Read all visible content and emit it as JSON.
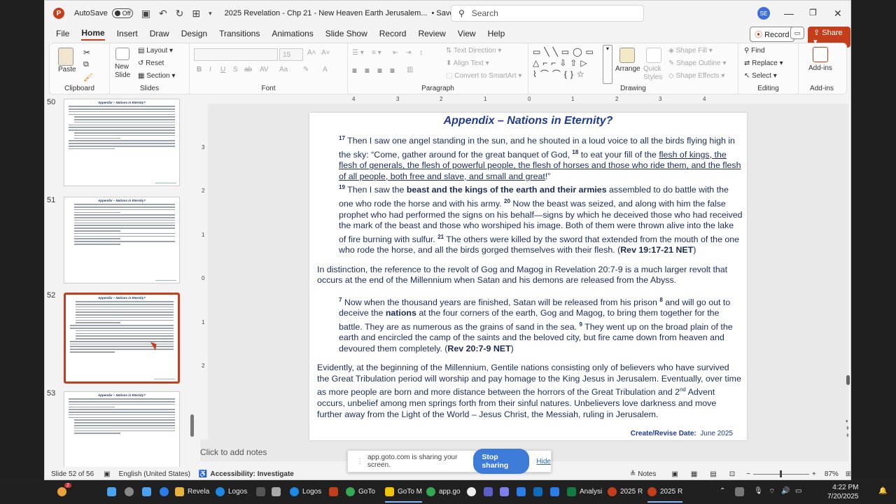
{
  "titlebar": {
    "autosave_label": "AutoSave",
    "autosave_state": "Off",
    "doc_title": "2025 Revelation - Chp 21 - New Heaven Earth Jerusalem...",
    "save_status": "• Saved to this PC",
    "search_placeholder": "Search",
    "user_initials": "SE"
  },
  "menu": {
    "tabs": [
      "File",
      "Home",
      "Insert",
      "Draw",
      "Design",
      "Transitions",
      "Animations",
      "Slide Show",
      "Record",
      "Review",
      "View",
      "Help"
    ],
    "record_button": "Record",
    "share_button": "Share"
  },
  "ribbon": {
    "clipboard": {
      "label": "Clipboard",
      "paste": "Paste"
    },
    "slides": {
      "label": "Slides",
      "new_slide": "New Slide",
      "layout": "Layout",
      "reset": "Reset",
      "section": "Section"
    },
    "font": {
      "label": "Font",
      "size": "15"
    },
    "paragraph": {
      "label": "Paragraph",
      "text_direction": "Text Direction",
      "align_text": "Align Text",
      "convert_smartart": "Convert to SmartArt"
    },
    "drawing": {
      "label": "Drawing",
      "arrange": "Arrange",
      "quick_styles": "Quick Styles",
      "shape_fill": "Shape Fill",
      "shape_outline": "Shape Outline",
      "shape_effects": "Shape Effects"
    },
    "editing": {
      "label": "Editing",
      "find": "Find",
      "replace": "Replace",
      "select": "Select"
    },
    "addins": {
      "label": "Add-ins",
      "addins": "Add-ins"
    }
  },
  "thumbnails": [
    {
      "number": "50",
      "title": "Appendix – Nations in Eternity?"
    },
    {
      "number": "51",
      "title": "Appendix – Nations in Eternity?"
    },
    {
      "number": "52",
      "title": "Appendix – Nations in Eternity?"
    },
    {
      "number": "53",
      "title": "Appendix – Nations in Eternity?"
    }
  ],
  "ruler": {
    "top": [
      "4",
      "3",
      "2",
      "1",
      "0",
      "1",
      "2",
      "3",
      "4"
    ],
    "left": [
      "3",
      "2",
      "1",
      "0",
      "1",
      "2"
    ]
  },
  "slide": {
    "title": "Appendix – Nations in Eternity?",
    "p1_v17": "17",
    "p1_a": " Then I saw one angel standing in the sun, and he shouted in a loud voice to all the birds flying high in the sky: “Come, gather around for the great banquet of God, ",
    "p1_v18": "18",
    "p1_b": " to eat your fill of the ",
    "p1_underline": "flesh of kings, the flesh of generals, the flesh of powerful people, the flesh of horses and those who ride them, and the flesh of all people, both free and slave, and small and great",
    "p1_c": "!”",
    "p1_v19": "19",
    "p1_d": " Then I saw the ",
    "p1_bold": "beast and the kings of the earth and their armies",
    "p1_e": " assembled to do battle with the one who rode the horse and with his army. ",
    "p1_v20": "20",
    "p1_f": " Now the beast was seized, and along with him the false prophet who had performed the signs on his behalf—signs by which he deceived those who had received the mark of the beast and those who worshiped his image. Both of them were thrown alive into the lake of fire burning with sulfur. ",
    "p1_v21": "21",
    "p1_g": " The others were killed by the sword that extended from the mouth of the one who rode the horse, and all the birds gorged themselves with their flesh. (",
    "p1_ref": "Rev 19:17-21 NET",
    "p1_h": ")",
    "p2": "In distinction, the reference to the revolt of Gog and Magog in Revelation 20:7-9 is a much larger revolt that occurs at the end of the Millennium when Satan and his demons are released from the Abyss.",
    "p3_v7": "7",
    "p3_a": " Now when the thousand years are finished, Satan will be released from his prison ",
    "p3_v8": "8",
    "p3_b": " and will go out to deceive the ",
    "p3_bold": "nations",
    "p3_c": " at the four corners of the earth, Gog and Magog, to bring them together for the battle. They are as numerous as the grains of sand in the sea. ",
    "p3_v9": "9",
    "p3_d": " They went up on the broad plain of the earth and encircled the camp of the saints and the beloved city, but fire came down from heaven and devoured them completely. (",
    "p3_ref": "Rev 20:7-9 NET",
    "p3_e": ")",
    "p4_a": "Evidently, at the beginning of the Millennium, Gentile nations consisting only of believers who have survived the Great Tribulation period will worship and pay homage to the King Jesus in Jerusalem. Eventually, over time as more people are born and more distance between the horrors of the Great Tribulation and 2",
    "p4_sup": "nd",
    "p4_b": " Advent occurs, unbelief among men springs forth from their sinful natures. Unbelievers love darkness and move further away from the Light of the World – Jesus Christ, the Messiah, ruling in Jerusalem.",
    "footer_label": "Create/Revise Date:",
    "footer_date": "June 2025"
  },
  "notes_placeholder": "Click to add notes",
  "sharing": {
    "message": "app.goto.com is sharing your screen.",
    "stop": "Stop sharing",
    "hide": "Hide"
  },
  "status": {
    "slide_count": "Slide 52 of 56",
    "language": "English (United States)",
    "accessibility": "Accessibility: Investigate",
    "notes": "Notes",
    "zoom": "87%"
  },
  "taskbar": {
    "items": [
      "Revela",
      "Logos",
      "Logos",
      "GoTo",
      "GoTo M",
      "app.go",
      "Analysi",
      "2025 R",
      "2025 R"
    ],
    "time": "4:22 PM",
    "date": "7/20/2025",
    "badge": "2"
  }
}
